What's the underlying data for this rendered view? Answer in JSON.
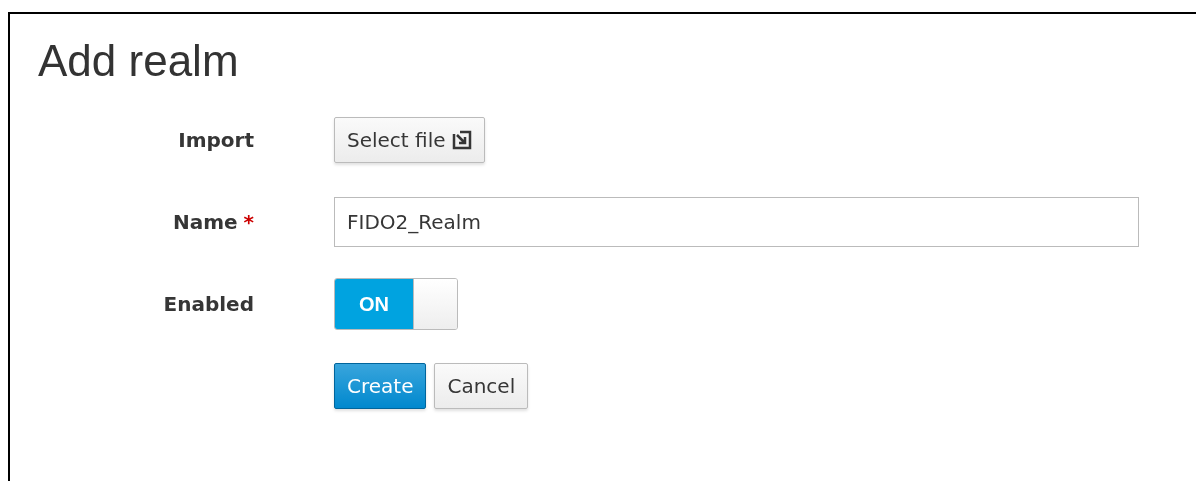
{
  "title": "Add realm",
  "import": {
    "label": "Import",
    "button": "Select file"
  },
  "name": {
    "label": "Name",
    "required_mark": "*",
    "value": "FIDO2_Realm"
  },
  "enabled": {
    "label": "Enabled",
    "on": true,
    "on_text": "ON"
  },
  "buttons": [
    {
      "label": "Create",
      "kind": "primary"
    },
    {
      "label": "Cancel",
      "kind": "default"
    }
  ]
}
